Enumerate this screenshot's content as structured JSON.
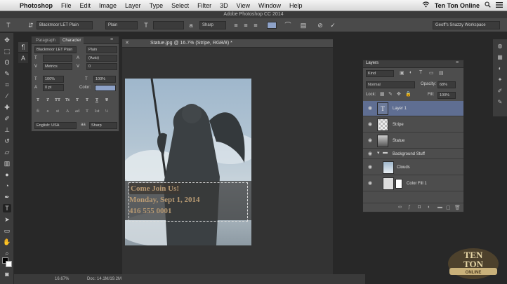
{
  "menubar": {
    "items": [
      "Photoshop",
      "File",
      "Edit",
      "Image",
      "Layer",
      "Type",
      "Select",
      "Filter",
      "3D",
      "View",
      "Window",
      "Help"
    ],
    "brand": "Ten Ton Online"
  },
  "app_title": "Adobe Photoshop CC 2014",
  "options": {
    "font_family": "Blackmoor LET Plain",
    "font_style": "Plain",
    "antialias": "Sharp",
    "workspace": "Geoff's Snazzy Workspace"
  },
  "character_panel": {
    "tabs": [
      "Paragraph",
      "Character"
    ],
    "font_family": "Blackmoor LET Plain",
    "font_style": "Plain",
    "leading": "(Auto)",
    "kerning": "Metrics",
    "tracking": "0",
    "vertical_scale": "100%",
    "horizontal_scale": "100%",
    "baseline_shift": "0 pt",
    "color_label": "Color:",
    "language": "English: USA",
    "aa_label": "aa",
    "antialias": "Sharp",
    "style_buttons": [
      "T",
      "T",
      "TT",
      "Tt",
      "T",
      "T",
      "T",
      "T"
    ],
    "glyph_buttons": [
      "fi",
      "o",
      "st",
      "A",
      "ad",
      "T",
      "1st",
      "½"
    ]
  },
  "document": {
    "tab_title": "Statue.jpg @ 16.7% (Stripe, RGB/8) *",
    "text_lines": [
      "Come Join Us!",
      "Monday, Sept 1, 2014",
      "416 555 0001"
    ]
  },
  "status": {
    "zoom": "16.67%",
    "doc_size": "Doc: 14.1M/19.2M"
  },
  "layers_panel": {
    "title": "Layers",
    "filter": "Kind",
    "blend_mode": "Normal",
    "opacity_label": "Opacity:",
    "opacity": "68%",
    "lock_label": "Lock:",
    "fill_label": "Fill:",
    "fill": "100%",
    "layers": [
      {
        "name": "Layer 1",
        "thumb": "T",
        "selected": true
      },
      {
        "name": "Stripe",
        "thumb": "",
        "selected": false
      },
      {
        "name": "Statue",
        "thumb": "",
        "selected": false
      },
      {
        "name": "Background Stuff",
        "thumb": "",
        "selected": false,
        "group": true
      },
      {
        "name": "Clouds",
        "thumb": "",
        "selected": false
      },
      {
        "name": "Color Fill 1",
        "thumb": "",
        "selected": false
      }
    ]
  },
  "watermark": {
    "line1": "TEN",
    "line2": "TON",
    "line3": "ONLINE"
  },
  "colors": {
    "accent_selected": "#5f6e92",
    "text_swatch": "#8ea2c8"
  }
}
